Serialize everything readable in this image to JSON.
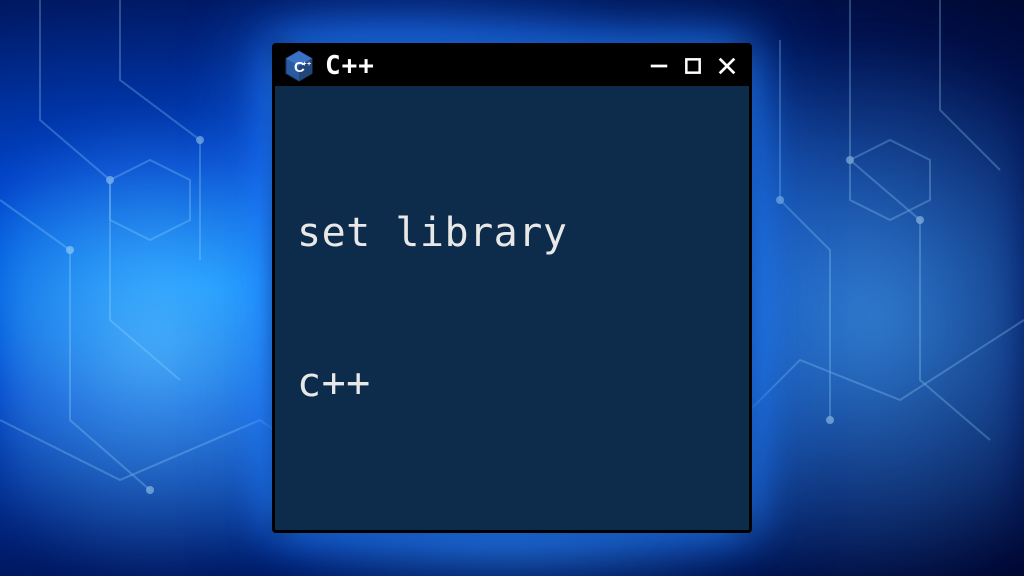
{
  "window": {
    "title": "C++",
    "icon_name": "cpp-hex-icon",
    "controls": {
      "minimize": "minimize",
      "maximize": "maximize",
      "close": "close"
    }
  },
  "content": {
    "line1": "set library",
    "line2": "c++"
  },
  "colors": {
    "window_bg": "#0d2b4a",
    "titlebar_bg": "#000000",
    "text": "#e8e8e8",
    "glow": "#2a8cff"
  }
}
